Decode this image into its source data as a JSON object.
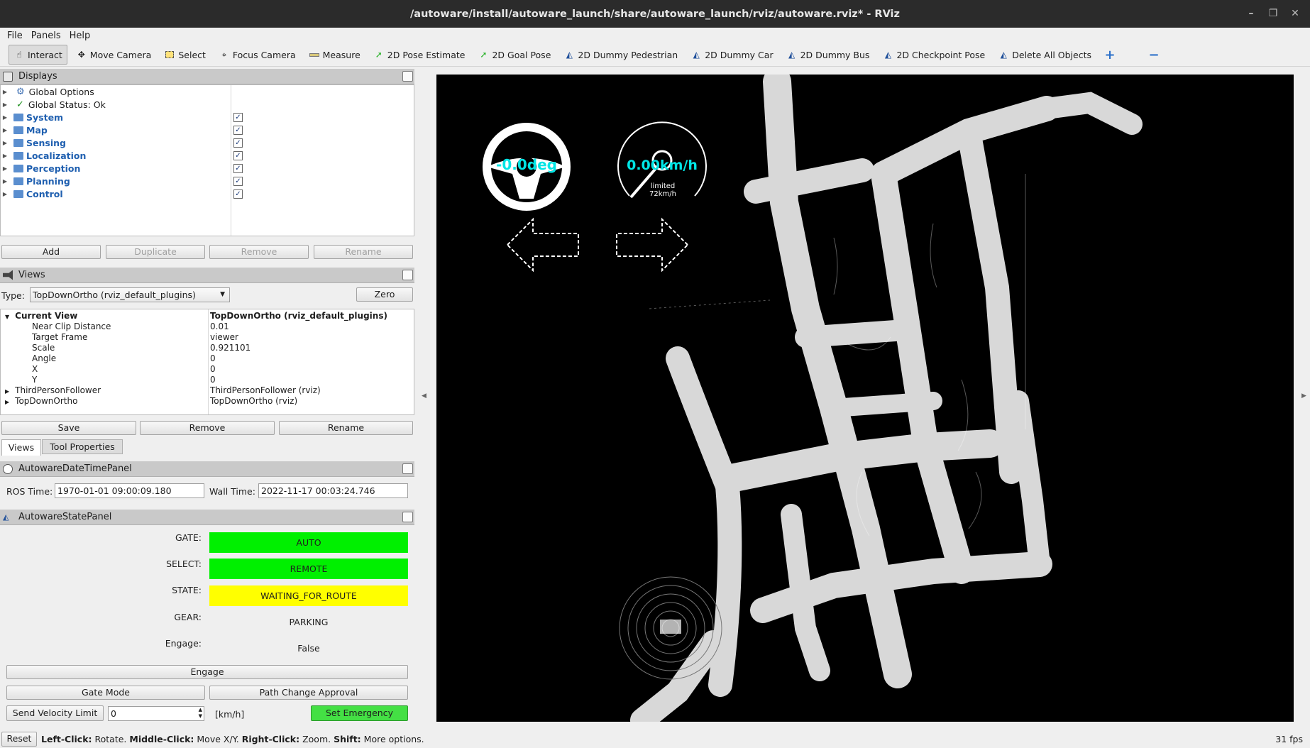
{
  "window": {
    "title": "/autoware/install/autoware_launch/share/autoware_launch/rviz/autoware.rviz* - RViz"
  },
  "menu": [
    "File",
    "Panels",
    "Help"
  ],
  "toolbar": {
    "tools": [
      {
        "label": "Interact",
        "icon": "hand-cursor-icon"
      },
      {
        "label": "Move Camera",
        "icon": "move-arrows-icon"
      },
      {
        "label": "Select",
        "icon": "select-box-icon"
      },
      {
        "label": "Focus Camera",
        "icon": "crosshair-icon"
      },
      {
        "label": "Measure",
        "icon": "ruler-icon"
      },
      {
        "label": "2D Pose Estimate",
        "icon": "green-arrow-icon"
      },
      {
        "label": "2D Goal Pose",
        "icon": "green-arrow-icon"
      },
      {
        "label": "2D Dummy Pedestrian",
        "icon": "autoware-logo-icon"
      },
      {
        "label": "2D Dummy Car",
        "icon": "autoware-logo-icon"
      },
      {
        "label": "2D Dummy Bus",
        "icon": "autoware-logo-icon"
      },
      {
        "label": "2D Checkpoint Pose",
        "icon": "autoware-logo-icon"
      },
      {
        "label": "Delete All Objects",
        "icon": "autoware-logo-icon"
      }
    ]
  },
  "displays": {
    "title": "Displays",
    "items": [
      {
        "label": "Global Options",
        "kind": "gear"
      },
      {
        "label": "Global Status: Ok",
        "kind": "check"
      },
      {
        "label": "System",
        "kind": "folder",
        "checked": true
      },
      {
        "label": "Map",
        "kind": "folder",
        "checked": true
      },
      {
        "label": "Sensing",
        "kind": "folder",
        "checked": true
      },
      {
        "label": "Localization",
        "kind": "folder",
        "checked": true
      },
      {
        "label": "Perception",
        "kind": "folder",
        "checked": true
      },
      {
        "label": "Planning",
        "kind": "folder",
        "checked": true
      },
      {
        "label": "Control",
        "kind": "folder",
        "checked": true
      }
    ],
    "buttons": {
      "add": "Add",
      "duplicate": "Duplicate",
      "remove": "Remove",
      "rename": "Rename"
    }
  },
  "views": {
    "title": "Views",
    "type_label": "Type:",
    "type_value": "TopDownOrtho (rviz_default_plugins)",
    "zero": "Zero",
    "rows": [
      {
        "name": "Current View",
        "value": "TopDownOrtho (rviz_default_plugins)",
        "bold": true,
        "expand": "open"
      },
      {
        "name": "Near Clip Distance",
        "value": "0.01",
        "indent": true
      },
      {
        "name": "Target Frame",
        "value": "viewer",
        "indent": true
      },
      {
        "name": "Scale",
        "value": "0.921101",
        "indent": true
      },
      {
        "name": "Angle",
        "value": "0",
        "indent": true
      },
      {
        "name": "X",
        "value": "0",
        "indent": true
      },
      {
        "name": "Y",
        "value": "0",
        "indent": true
      },
      {
        "name": "ThirdPersonFollower",
        "value": "ThirdPersonFollower (rviz)",
        "expand": "closed"
      },
      {
        "name": "TopDownOrtho",
        "value": "TopDownOrtho (rviz)",
        "expand": "closed"
      }
    ],
    "buttons": {
      "save": "Save",
      "remove": "Remove",
      "rename": "Rename"
    },
    "tabs": [
      "Views",
      "Tool Properties"
    ]
  },
  "datetime": {
    "title": "AutowareDateTimePanel",
    "ros_label": "ROS Time:",
    "ros_value": "1970-01-01 09:00:09.180",
    "wall_label": "Wall Time:",
    "wall_value": "2022-11-17 00:03:24.746"
  },
  "state": {
    "title": "AutowareStatePanel",
    "gate_label": "GATE:",
    "gate_value": "AUTO",
    "select_label": "SELECT:",
    "select_value": "REMOTE",
    "state_label": "STATE:",
    "state_value": "WAITING_FOR_ROUTE",
    "gear_label": "GEAR:",
    "gear_value": "PARKING",
    "engage_label": "Engage:",
    "engage_value": "False",
    "engage_btn": "Engage",
    "gate_mode_btn": "Gate Mode",
    "path_change_btn": "Path Change Approval",
    "velocity_btn": "Send Velocity Limit",
    "velocity_value": "0",
    "velocity_unit": "[km/h]",
    "emergency_btn": "Set Emergency",
    "colors": {
      "green": "#00f000",
      "yellow": "#ffff00"
    }
  },
  "overlay": {
    "steering": "-0.0deg",
    "speed": "0.00km/h",
    "limit_line1": "limited",
    "limit_line2": "72km/h",
    "accent": "#00e5e5"
  },
  "status": {
    "reset": "Reset",
    "hint_left_key": "Left-Click:",
    "hint_left": " Rotate. ",
    "hint_mid_key": "Middle-Click:",
    "hint_mid": " Move X/Y. ",
    "hint_right_key": "Right-Click:",
    "hint_right": " Zoom. ",
    "hint_shift_key": "Shift:",
    "hint_shift": " More options.",
    "fps": "31 fps"
  }
}
